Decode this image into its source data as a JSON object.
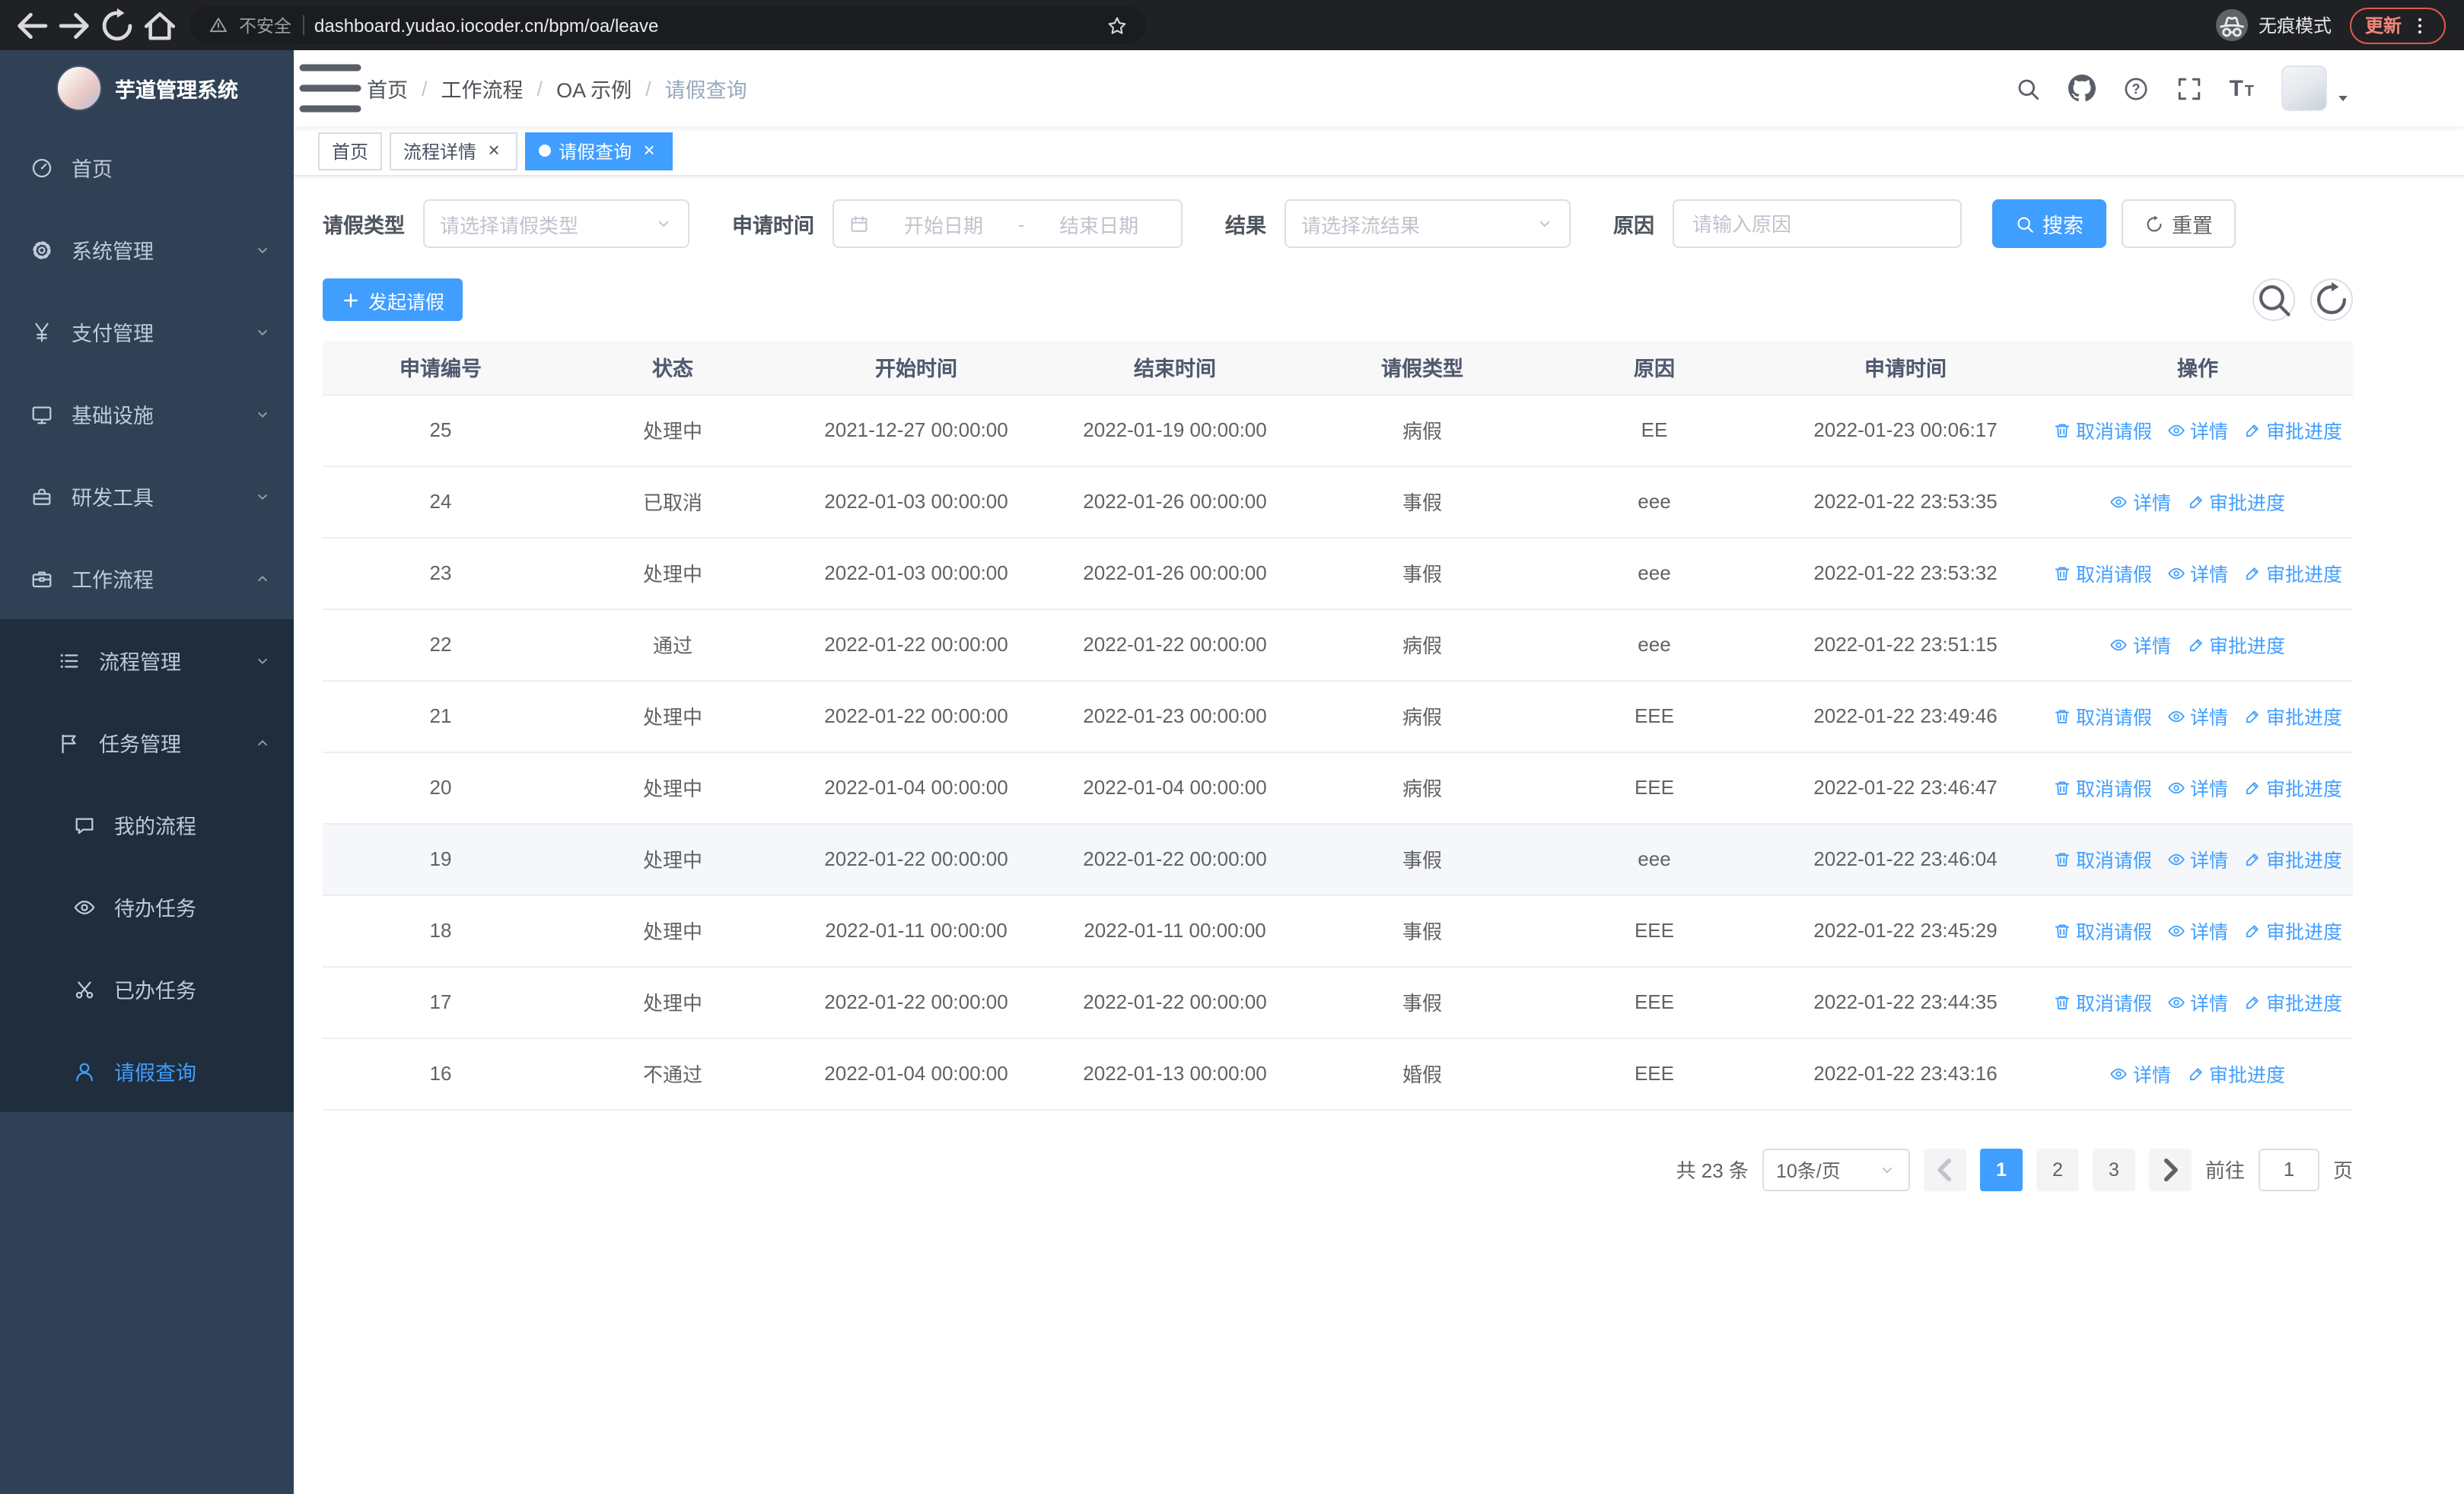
{
  "browser": {
    "security_label": "不安全",
    "url": "dashboard.yudao.iocoder.cn/bpm/oa/leave",
    "incognito_label": "无痕模式",
    "update_label": "更新"
  },
  "sidebar": {
    "logo_title": "芋道管理系统",
    "items": [
      {
        "key": "home",
        "label": "首页",
        "icon": "dashboard-icon",
        "level": 1
      },
      {
        "key": "system-management",
        "label": "系统管理",
        "icon": "gear-icon",
        "level": 1,
        "chevron": "down"
      },
      {
        "key": "payment-management",
        "label": "支付管理",
        "icon": "yen-icon",
        "level": 1,
        "chevron": "down"
      },
      {
        "key": "infrastructure",
        "label": "基础设施",
        "icon": "monitor-icon",
        "level": 1,
        "chevron": "down"
      },
      {
        "key": "dev-tools",
        "label": "研发工具",
        "icon": "toolbox-icon",
        "level": 1,
        "chevron": "down"
      },
      {
        "key": "workflow",
        "label": "工作流程",
        "icon": "briefcase-icon",
        "level": 1,
        "chevron": "up"
      },
      {
        "key": "process-management",
        "label": "流程管理",
        "icon": "list-icon",
        "level": 2,
        "sub": true,
        "chevron": "down"
      },
      {
        "key": "task-management",
        "label": "任务管理",
        "icon": "flag-icon",
        "level": 2,
        "sub": true,
        "chevron": "up"
      },
      {
        "key": "my-processes",
        "label": "我的流程",
        "icon": "chat-icon",
        "level": 3,
        "sub": true
      },
      {
        "key": "todo-tasks",
        "label": "待办任务",
        "icon": "eye-icon",
        "level": 3,
        "sub": true
      },
      {
        "key": "done-tasks",
        "label": "已办任务",
        "icon": "scissors-icon",
        "level": 3,
        "sub": true
      },
      {
        "key": "leave-query",
        "label": "请假查询",
        "icon": "user-icon",
        "level": 3,
        "sub": true,
        "active": true
      }
    ]
  },
  "navbar": {
    "breadcrumb": [
      {
        "key": "home",
        "label": "首页"
      },
      {
        "key": "workflow",
        "label": "工作流程"
      },
      {
        "key": "oa-example",
        "label": "OA 示例"
      },
      {
        "key": "leave-query",
        "label": "请假查询",
        "current": true
      }
    ]
  },
  "tabs": [
    {
      "key": "home",
      "label": "首页"
    },
    {
      "key": "process-detail",
      "label": "流程详情",
      "closable": true
    },
    {
      "key": "leave-query",
      "label": "请假查询",
      "closable": true,
      "active": true
    }
  ],
  "filters": {
    "leave_type": {
      "label": "请假类型",
      "placeholder": "请选择请假类型"
    },
    "apply_time": {
      "label": "申请时间",
      "start_placeholder": "开始日期",
      "separator": "-",
      "end_placeholder": "结束日期"
    },
    "result": {
      "label": "结果",
      "placeholder": "请选择流结果"
    },
    "reason": {
      "label": "原因",
      "placeholder": "请输入原因"
    },
    "search_button": "搜索",
    "reset_button": "重置"
  },
  "toolbar": {
    "create_button": "发起请假"
  },
  "table": {
    "columns": [
      "申请编号",
      "状态",
      "开始时间",
      "结束时间",
      "请假类型",
      "原因",
      "申请时间",
      "操作"
    ],
    "action_labels": {
      "cancel": "取消请假",
      "detail": "详情",
      "progress": "审批进度"
    },
    "rows": [
      {
        "id": "25",
        "status": "处理中",
        "start_time": "2021-12-27 00:00:00",
        "end_time": "2022-01-19 00:00:00",
        "leave_type": "病假",
        "reason": "EE",
        "apply_time": "2022-01-23 00:06:17",
        "cancellable": true
      },
      {
        "id": "24",
        "status": "已取消",
        "start_time": "2022-01-03 00:00:00",
        "end_time": "2022-01-26 00:00:00",
        "leave_type": "事假",
        "reason": "eee",
        "apply_time": "2022-01-22 23:53:35",
        "cancellable": false
      },
      {
        "id": "23",
        "status": "处理中",
        "start_time": "2022-01-03 00:00:00",
        "end_time": "2022-01-26 00:00:00",
        "leave_type": "事假",
        "reason": "eee",
        "apply_time": "2022-01-22 23:53:32",
        "cancellable": true
      },
      {
        "id": "22",
        "status": "通过",
        "start_time": "2022-01-22 00:00:00",
        "end_time": "2022-01-22 00:00:00",
        "leave_type": "病假",
        "reason": "eee",
        "apply_time": "2022-01-22 23:51:15",
        "cancellable": false
      },
      {
        "id": "21",
        "status": "处理中",
        "start_time": "2022-01-22 00:00:00",
        "end_time": "2022-01-23 00:00:00",
        "leave_type": "病假",
        "reason": "EEE",
        "apply_time": "2022-01-22 23:49:46",
        "cancellable": true
      },
      {
        "id": "20",
        "status": "处理中",
        "start_time": "2022-01-04 00:00:00",
        "end_time": "2022-01-04 00:00:00",
        "leave_type": "病假",
        "reason": "EEE",
        "apply_time": "2022-01-22 23:46:47",
        "cancellable": true
      },
      {
        "id": "19",
        "status": "处理中",
        "start_time": "2022-01-22 00:00:00",
        "end_time": "2022-01-22 00:00:00",
        "leave_type": "事假",
        "reason": "eee",
        "apply_time": "2022-01-22 23:46:04",
        "cancellable": true,
        "highlighted": true
      },
      {
        "id": "18",
        "status": "处理中",
        "start_time": "2022-01-11 00:00:00",
        "end_time": "2022-01-11 00:00:00",
        "leave_type": "事假",
        "reason": "EEE",
        "apply_time": "2022-01-22 23:45:29",
        "cancellable": true
      },
      {
        "id": "17",
        "status": "处理中",
        "start_time": "2022-01-22 00:00:00",
        "end_time": "2022-01-22 00:00:00",
        "leave_type": "事假",
        "reason": "EEE",
        "apply_time": "2022-01-22 23:44:35",
        "cancellable": true
      },
      {
        "id": "16",
        "status": "不通过",
        "start_time": "2022-01-04 00:00:00",
        "end_time": "2022-01-13 00:00:00",
        "leave_type": "婚假",
        "reason": "EEE",
        "apply_time": "2022-01-22 23:43:16",
        "cancellable": false
      }
    ]
  },
  "pagination": {
    "total_label": "共 23 条",
    "page_size": "10条/页",
    "pages": [
      "1",
      "2",
      "3"
    ],
    "active_page": "1",
    "goto_label": "前往",
    "goto_value": "1",
    "page_unit": "页"
  },
  "colors": {
    "primary": "#409eff",
    "sidebar_bg": "#304156",
    "submenu_bg": "#1f2d3d",
    "browser_bar_bg": "#202124"
  },
  "icons": {
    "security-warning-icon": "triangle-exclamation",
    "bookmark-star-icon": "star-outline",
    "incognito-icon": "spy-hat-glasses",
    "kebab-menu-icon": "vertical-dots",
    "search-icon": "magnifier",
    "github-icon": "octocat",
    "question-icon": "question-circle",
    "fullscreen-icon": "expand-corners",
    "font-size-icon": "double-T",
    "trash-icon": "trash-can",
    "eye-icon": "eye",
    "edit-icon": "pen"
  }
}
